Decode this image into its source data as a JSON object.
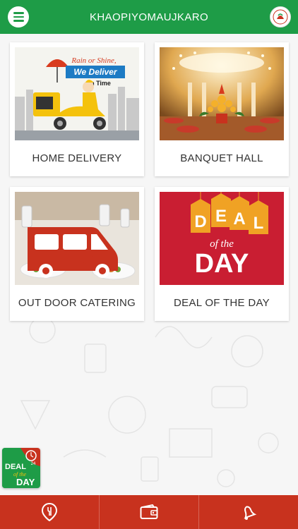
{
  "header": {
    "title": "KHAOPIYOMAUJKARO"
  },
  "cards": [
    {
      "label": "HOME DELIVERY",
      "banner_line1": "Rain or Shine,",
      "banner_line2": "We Deliver",
      "banner_line3": "On Time"
    },
    {
      "label": "BANQUET HALL"
    },
    {
      "label": "OUT DOOR CATERING"
    },
    {
      "label": "DEAL OF THE DAY",
      "tags": [
        "D",
        "E",
        "A",
        "L"
      ],
      "of_the": "of the",
      "day": "DAY"
    }
  ],
  "floating_deal": {
    "line1": "DEAL",
    "line2": "of the",
    "line3": "DAY",
    "clock": "24"
  },
  "bottom_nav": {
    "items": [
      {
        "icon": "location-pin-icon"
      },
      {
        "icon": "wallet-icon"
      },
      {
        "icon": "bell-icon"
      }
    ]
  },
  "colors": {
    "header_green": "#1e9c47",
    "bottom_red": "#c8321e",
    "deal_red": "#c91e32",
    "tag_orange": "#f0a224"
  }
}
